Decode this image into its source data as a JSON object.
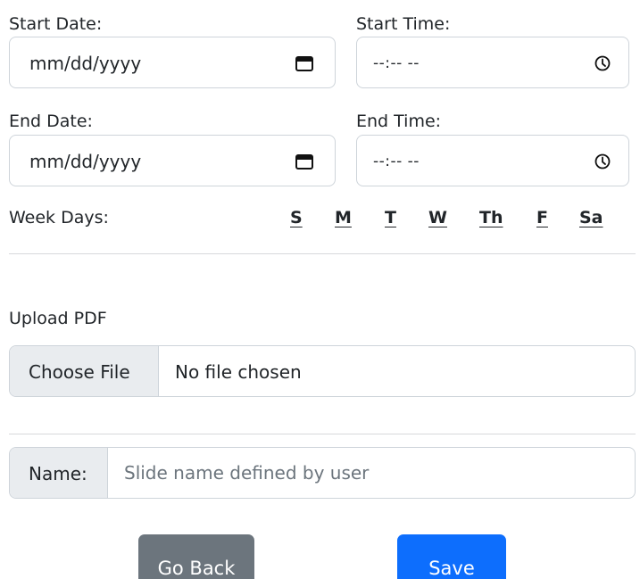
{
  "form": {
    "start_date_label": "Start Date:",
    "start_date_placeholder": "mm/dd/yyyy",
    "start_time_label": "Start Time:",
    "start_time_placeholder": "--:-- --",
    "end_date_label": "End Date:",
    "end_date_placeholder": "mm/dd/yyyy",
    "end_time_label": "End Time:",
    "end_time_placeholder": "--:-- --",
    "weekdays_label": "Week Days:",
    "weekdays": [
      "S",
      "M",
      "T",
      "W",
      "Th",
      "F",
      "Sa"
    ],
    "upload_label": "Upload PDF",
    "file_button_label": "Choose File",
    "file_status": "No file chosen",
    "name_label": "Name:",
    "name_placeholder": "Slide name defined by user"
  },
  "actions": {
    "back_label": "Go Back",
    "save_label": "Save"
  },
  "colors": {
    "primary": "#0d6efd",
    "secondary": "#6c757d",
    "border": "#ced4da",
    "addon_background": "#e9ecef"
  }
}
